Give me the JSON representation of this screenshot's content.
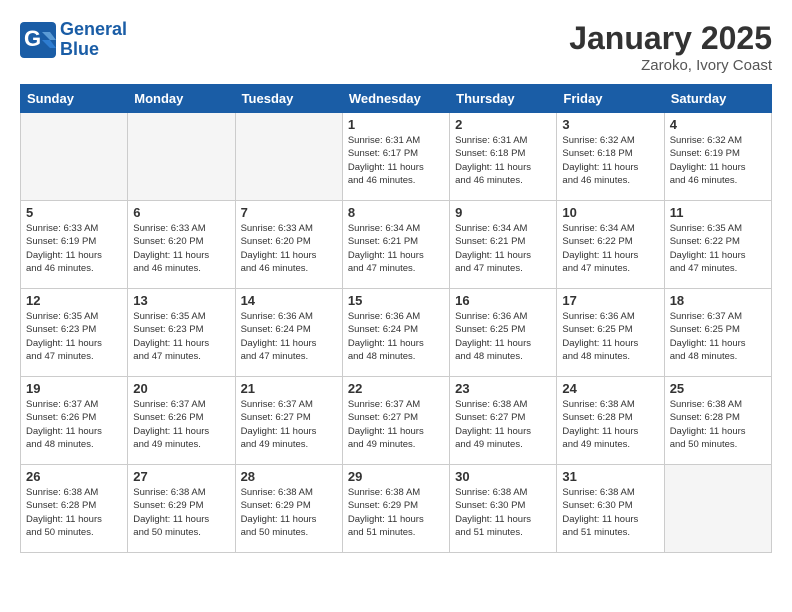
{
  "header": {
    "logo_line1": "General",
    "logo_line2": "Blue",
    "month": "January 2025",
    "location": "Zaroko, Ivory Coast"
  },
  "weekdays": [
    "Sunday",
    "Monday",
    "Tuesday",
    "Wednesday",
    "Thursday",
    "Friday",
    "Saturday"
  ],
  "weeks": [
    [
      {
        "num": "",
        "info": ""
      },
      {
        "num": "",
        "info": ""
      },
      {
        "num": "",
        "info": ""
      },
      {
        "num": "1",
        "info": "Sunrise: 6:31 AM\nSunset: 6:17 PM\nDaylight: 11 hours\nand 46 minutes."
      },
      {
        "num": "2",
        "info": "Sunrise: 6:31 AM\nSunset: 6:18 PM\nDaylight: 11 hours\nand 46 minutes."
      },
      {
        "num": "3",
        "info": "Sunrise: 6:32 AM\nSunset: 6:18 PM\nDaylight: 11 hours\nand 46 minutes."
      },
      {
        "num": "4",
        "info": "Sunrise: 6:32 AM\nSunset: 6:19 PM\nDaylight: 11 hours\nand 46 minutes."
      }
    ],
    [
      {
        "num": "5",
        "info": "Sunrise: 6:33 AM\nSunset: 6:19 PM\nDaylight: 11 hours\nand 46 minutes."
      },
      {
        "num": "6",
        "info": "Sunrise: 6:33 AM\nSunset: 6:20 PM\nDaylight: 11 hours\nand 46 minutes."
      },
      {
        "num": "7",
        "info": "Sunrise: 6:33 AM\nSunset: 6:20 PM\nDaylight: 11 hours\nand 46 minutes."
      },
      {
        "num": "8",
        "info": "Sunrise: 6:34 AM\nSunset: 6:21 PM\nDaylight: 11 hours\nand 47 minutes."
      },
      {
        "num": "9",
        "info": "Sunrise: 6:34 AM\nSunset: 6:21 PM\nDaylight: 11 hours\nand 47 minutes."
      },
      {
        "num": "10",
        "info": "Sunrise: 6:34 AM\nSunset: 6:22 PM\nDaylight: 11 hours\nand 47 minutes."
      },
      {
        "num": "11",
        "info": "Sunrise: 6:35 AM\nSunset: 6:22 PM\nDaylight: 11 hours\nand 47 minutes."
      }
    ],
    [
      {
        "num": "12",
        "info": "Sunrise: 6:35 AM\nSunset: 6:23 PM\nDaylight: 11 hours\nand 47 minutes."
      },
      {
        "num": "13",
        "info": "Sunrise: 6:35 AM\nSunset: 6:23 PM\nDaylight: 11 hours\nand 47 minutes."
      },
      {
        "num": "14",
        "info": "Sunrise: 6:36 AM\nSunset: 6:24 PM\nDaylight: 11 hours\nand 47 minutes."
      },
      {
        "num": "15",
        "info": "Sunrise: 6:36 AM\nSunset: 6:24 PM\nDaylight: 11 hours\nand 48 minutes."
      },
      {
        "num": "16",
        "info": "Sunrise: 6:36 AM\nSunset: 6:25 PM\nDaylight: 11 hours\nand 48 minutes."
      },
      {
        "num": "17",
        "info": "Sunrise: 6:36 AM\nSunset: 6:25 PM\nDaylight: 11 hours\nand 48 minutes."
      },
      {
        "num": "18",
        "info": "Sunrise: 6:37 AM\nSunset: 6:25 PM\nDaylight: 11 hours\nand 48 minutes."
      }
    ],
    [
      {
        "num": "19",
        "info": "Sunrise: 6:37 AM\nSunset: 6:26 PM\nDaylight: 11 hours\nand 48 minutes."
      },
      {
        "num": "20",
        "info": "Sunrise: 6:37 AM\nSunset: 6:26 PM\nDaylight: 11 hours\nand 49 minutes."
      },
      {
        "num": "21",
        "info": "Sunrise: 6:37 AM\nSunset: 6:27 PM\nDaylight: 11 hours\nand 49 minutes."
      },
      {
        "num": "22",
        "info": "Sunrise: 6:37 AM\nSunset: 6:27 PM\nDaylight: 11 hours\nand 49 minutes."
      },
      {
        "num": "23",
        "info": "Sunrise: 6:38 AM\nSunset: 6:27 PM\nDaylight: 11 hours\nand 49 minutes."
      },
      {
        "num": "24",
        "info": "Sunrise: 6:38 AM\nSunset: 6:28 PM\nDaylight: 11 hours\nand 49 minutes."
      },
      {
        "num": "25",
        "info": "Sunrise: 6:38 AM\nSunset: 6:28 PM\nDaylight: 11 hours\nand 50 minutes."
      }
    ],
    [
      {
        "num": "26",
        "info": "Sunrise: 6:38 AM\nSunset: 6:28 PM\nDaylight: 11 hours\nand 50 minutes."
      },
      {
        "num": "27",
        "info": "Sunrise: 6:38 AM\nSunset: 6:29 PM\nDaylight: 11 hours\nand 50 minutes."
      },
      {
        "num": "28",
        "info": "Sunrise: 6:38 AM\nSunset: 6:29 PM\nDaylight: 11 hours\nand 50 minutes."
      },
      {
        "num": "29",
        "info": "Sunrise: 6:38 AM\nSunset: 6:29 PM\nDaylight: 11 hours\nand 51 minutes."
      },
      {
        "num": "30",
        "info": "Sunrise: 6:38 AM\nSunset: 6:30 PM\nDaylight: 11 hours\nand 51 minutes."
      },
      {
        "num": "31",
        "info": "Sunrise: 6:38 AM\nSunset: 6:30 PM\nDaylight: 11 hours\nand 51 minutes."
      },
      {
        "num": "",
        "info": ""
      }
    ]
  ]
}
